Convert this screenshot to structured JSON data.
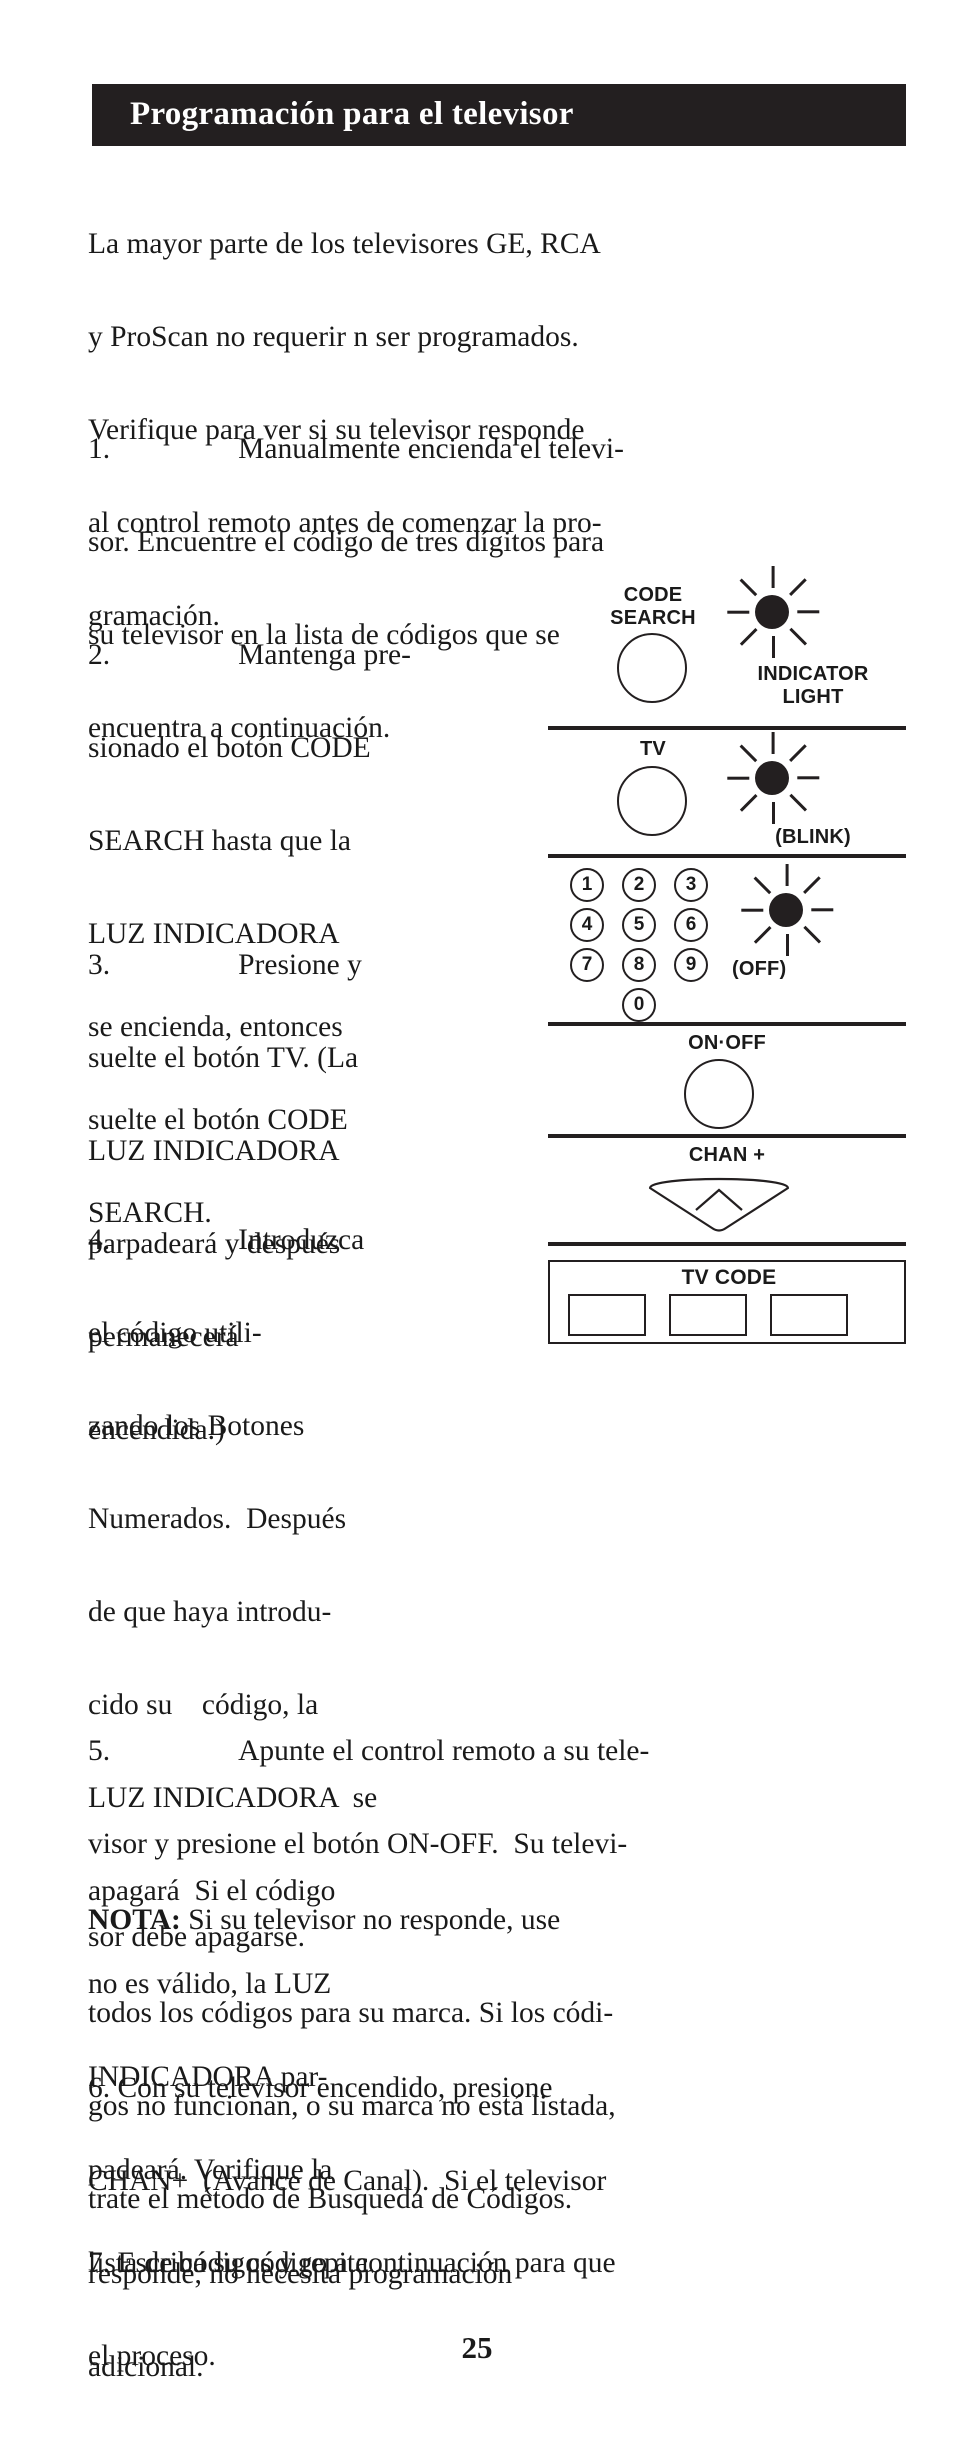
{
  "page": {
    "number": "25",
    "title": "Programación para el televisor"
  },
  "intro": {
    "lines": [
      "La mayor parte de los televisores GE, RCA",
      "y ProScan no requerir n ser programados.",
      "Verifique para ver si su televisor responde",
      "al control remoto antes de comenzar la pro-",
      "gramación."
    ]
  },
  "steps": {
    "step1": {
      "number": "1.",
      "lines": [
        "Manualmente encienda el televi-",
        "sor. Encuentre el código de tres dígitos para",
        "su televisor en la lista de códigos que se",
        "encuentra a continuación."
      ]
    },
    "step2": {
      "number": "2.",
      "lines": [
        "Mantenga pre-",
        "sionado el botón CODE",
        "SEARCH hasta que la",
        "LUZ INDICADORA",
        "se encienda, entonces",
        "suelte el botón CODE",
        "SEARCH."
      ]
    },
    "step3": {
      "number": "3.",
      "lines": [
        "Presione y",
        "suelte el botón TV. (La",
        "LUZ INDICADORA",
        "parpadeará y después",
        "permanecerá",
        "encendida.)"
      ]
    },
    "step4": {
      "number": "4.",
      "lines": [
        "Introduzca",
        "el código utili-",
        "zando los Botones",
        "Numerados.  Después",
        "de que haya introdu-",
        "cido su    código, la",
        "LUZ INDICADORA  se",
        "apagará  Si el código",
        "no es válido, la LUZ",
        "INDICADORA par-",
        "padeará. Verifique la",
        "lista de códigos y repita",
        "el proceso."
      ]
    },
    "step5": {
      "number": "5.",
      "lines": [
        "Apunte el control remoto a su tele-",
        "visor y presione el botón ON-OFF.  Su televi-",
        "sor debe apagarse."
      ]
    },
    "note": {
      "label": "NOTA:",
      "lines": [
        " Si su televisor no responde, use",
        "todos los códigos para su marca. Si los códi-",
        "gos no funcionan, o su marca no está listada,",
        "trate el método de Busqueda de Códigos."
      ]
    },
    "step6": {
      "lines": [
        "6. Con su televisor encendido, presione",
        "CHAN+  (Avance de Canal).  Si el televisor",
        "responde, no necesita programación",
        "adicional."
      ]
    },
    "step7": {
      "lines": [
        "7. Escriba su código a continuación para que"
      ]
    }
  },
  "diagram": {
    "panels": [
      {
        "id": "code-search",
        "button_label_line1": "CODE",
        "button_label_line2": "SEARCH",
        "light_label_line1": "INDICATOR",
        "light_label_line2": "LIGHT"
      },
      {
        "id": "tv",
        "button_label": "TV",
        "light_label": "(BLINK)"
      },
      {
        "id": "keypad",
        "keys": [
          "1",
          "2",
          "3",
          "4",
          "5",
          "6",
          "7",
          "8",
          "9",
          "0"
        ],
        "light_label": "(OFF)"
      },
      {
        "id": "on-off",
        "button_label": "ON·OFF"
      },
      {
        "id": "chan-plus",
        "button_label": "CHAN +"
      },
      {
        "id": "tv-code",
        "box_label": "TV CODE",
        "slots": [
          "",
          "",
          ""
        ]
      }
    ]
  },
  "colors": {
    "ink": "#231f20",
    "paper": "#ffffff",
    "banner_bg": "#231f20",
    "banner_text": "#ffffff"
  }
}
